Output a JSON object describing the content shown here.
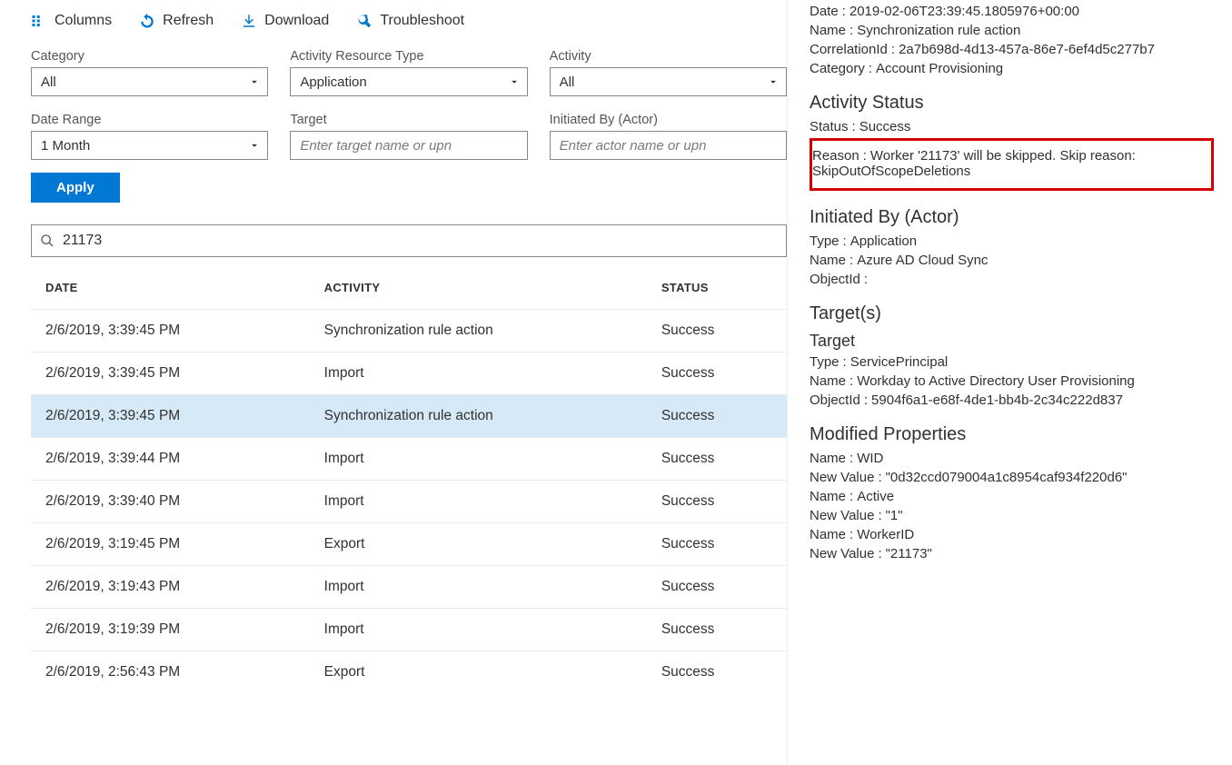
{
  "toolbar": {
    "columns": "Columns",
    "refresh": "Refresh",
    "download": "Download",
    "troubleshoot": "Troubleshoot"
  },
  "filters": {
    "category": {
      "label": "Category",
      "value": "All"
    },
    "resType": {
      "label": "Activity Resource Type",
      "value": "Application"
    },
    "activity": {
      "label": "Activity",
      "value": "All"
    },
    "dateRange": {
      "label": "Date Range",
      "value": "1 Month"
    },
    "target": {
      "label": "Target",
      "placeholder": "Enter target name or upn"
    },
    "initiatedBy": {
      "label": "Initiated By (Actor)",
      "placeholder": "Enter actor name or upn"
    },
    "applyLabel": "Apply"
  },
  "search": {
    "value": "21173"
  },
  "table": {
    "headers": {
      "date": "DATE",
      "activity": "ACTIVITY",
      "status": "STATUS"
    },
    "rows": [
      {
        "date": "2/6/2019, 3:39:45 PM",
        "activity": "Synchronization rule action",
        "status": "Success"
      },
      {
        "date": "2/6/2019, 3:39:45 PM",
        "activity": "Import",
        "status": "Success"
      },
      {
        "date": "2/6/2019, 3:39:45 PM",
        "activity": "Synchronization rule action",
        "status": "Success"
      },
      {
        "date": "2/6/2019, 3:39:44 PM",
        "activity": "Import",
        "status": "Success"
      },
      {
        "date": "2/6/2019, 3:39:40 PM",
        "activity": "Import",
        "status": "Success"
      },
      {
        "date": "2/6/2019, 3:19:45 PM",
        "activity": "Export",
        "status": "Success"
      },
      {
        "date": "2/6/2019, 3:19:43 PM",
        "activity": "Import",
        "status": "Success"
      },
      {
        "date": "2/6/2019, 3:19:39 PM",
        "activity": "Import",
        "status": "Success"
      },
      {
        "date": "2/6/2019, 2:56:43 PM",
        "activity": "Export",
        "status": "Success"
      }
    ],
    "selectedIndex": 2
  },
  "details": {
    "top": {
      "dateLabel": "Date",
      "dateValue": "2019-02-06T23:39:45.1805976+00:00",
      "nameLabel": "Name",
      "nameValue": "Synchronization rule action",
      "corrLabel": "CorrelationId",
      "corrValue": "2a7b698d-4d13-457a-86e7-6ef4d5c277b7",
      "catLabel": "Category",
      "catValue": "Account Provisioning"
    },
    "activityStatus": {
      "heading": "Activity Status",
      "statusLabel": "Status",
      "statusValue": "Success",
      "reasonLabel": "Reason",
      "reasonValue": "Worker '21173' will be skipped. Skip reason: SkipOutOfScopeDeletions"
    },
    "initiatedBy": {
      "heading": "Initiated By (Actor)",
      "typeLabel": "Type",
      "typeValue": "Application",
      "nameLabel": "Name",
      "nameValue": "Azure AD Cloud Sync",
      "objLabel": "ObjectId",
      "objValue": ""
    },
    "targets": {
      "heading": "Target(s)",
      "subheading": "Target",
      "typeLabel": "Type",
      "typeValue": "ServicePrincipal",
      "nameLabel": "Name",
      "nameValue": "Workday to Active Directory User Provisioning",
      "objLabel": "ObjectId",
      "objValue": "5904f6a1-e68f-4de1-bb4b-2c34c222d837"
    },
    "modified": {
      "heading": "Modified Properties",
      "items": [
        {
          "nameLabel": "Name",
          "nameValue": "WID",
          "newLabel": "New Value",
          "newValue": "\"0d32ccd079004a1c8954caf934f220d6\""
        },
        {
          "nameLabel": "Name",
          "nameValue": "Active",
          "newLabel": "New Value",
          "newValue": "\"1\""
        },
        {
          "nameLabel": "Name",
          "nameValue": "WorkerID",
          "newLabel": "New Value",
          "newValue": "\"21173\""
        }
      ]
    }
  }
}
